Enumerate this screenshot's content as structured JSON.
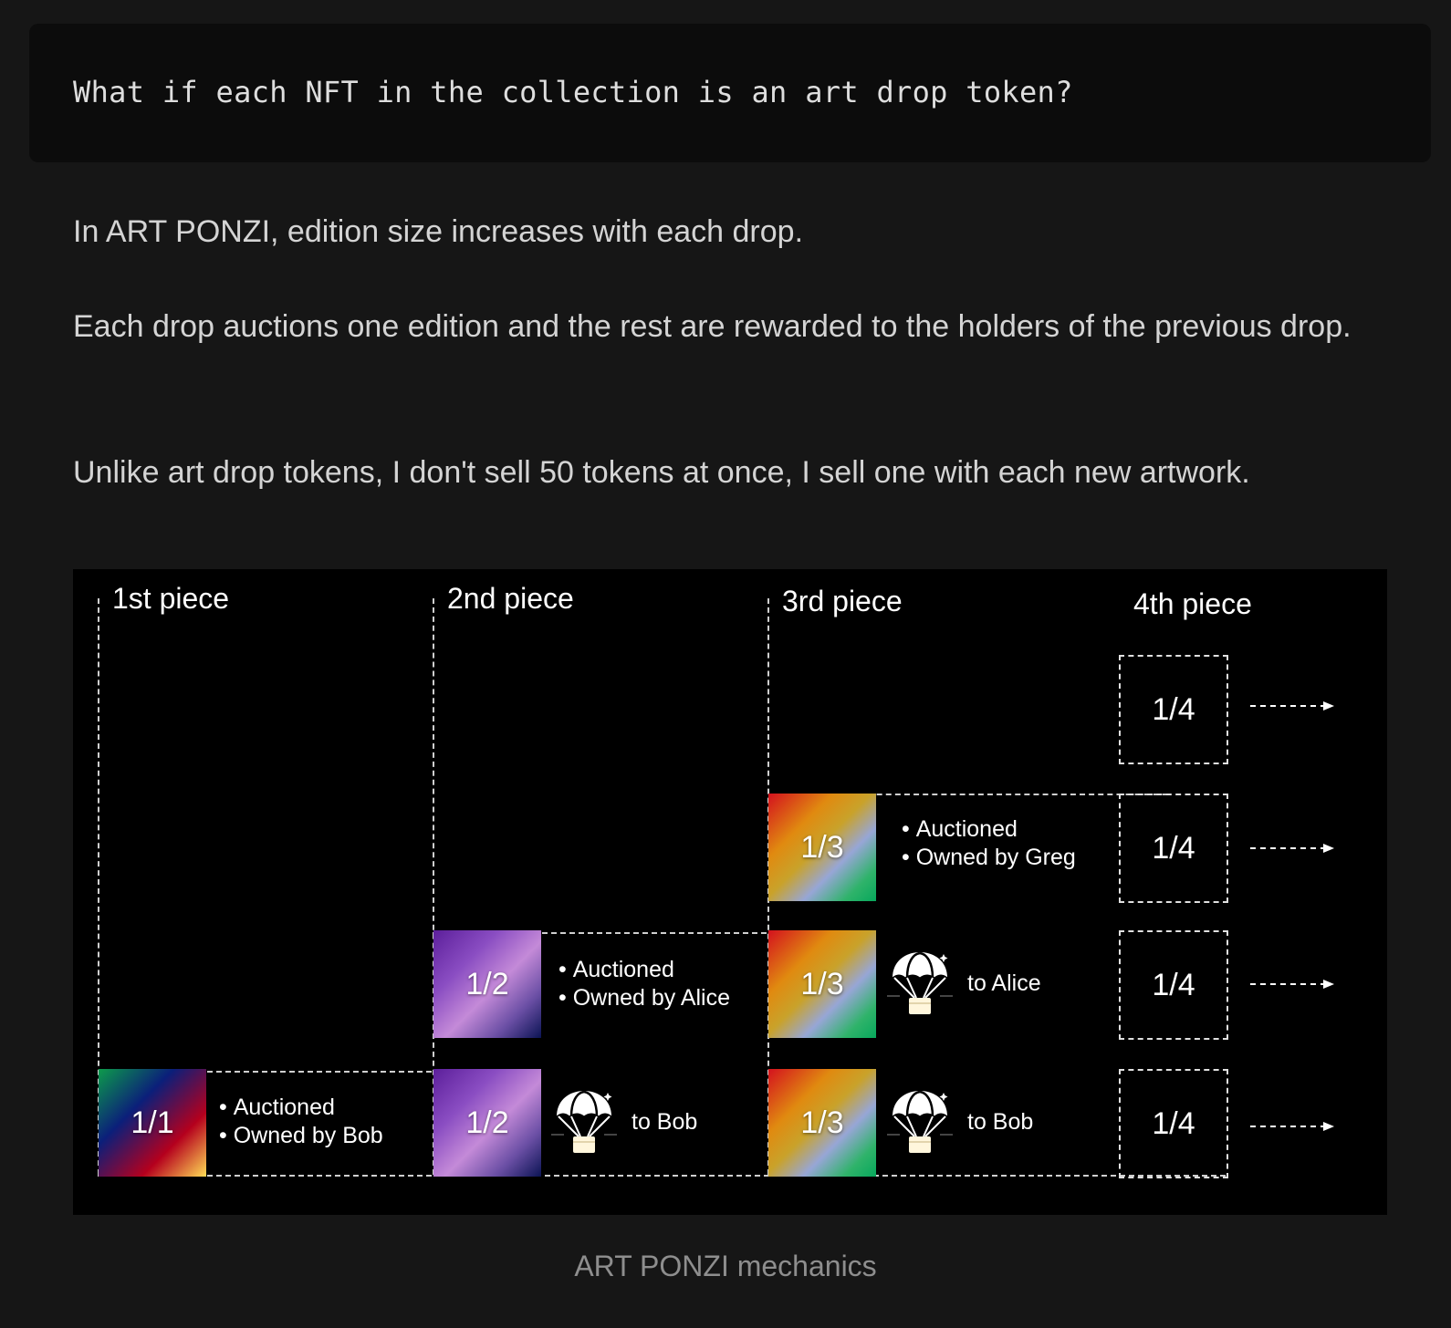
{
  "question": "What if each NFT in the collection is an art drop token?",
  "paragraphs": [
    "In ART PONZI, edition size increases with each drop.",
    "Each drop auctions one edition and the rest are rewarded to the holders of the previous drop.",
    "Unlike art drop tokens, I don't sell 50 tokens at once, I sell one with each new artwork."
  ],
  "diagram": {
    "columns": [
      "1st piece",
      "2nd piece",
      "3rd piece",
      "4th piece"
    ],
    "tiles": {
      "p1_r1": "1/1",
      "p2_r1": "1/2",
      "p2_r2": "1/2",
      "p3_r1": "1/3",
      "p3_r2": "1/3",
      "p3_r3": "1/3",
      "p4_r1": "1/4",
      "p4_r2": "1/4",
      "p4_r3": "1/4",
      "p4_r4": "1/4"
    },
    "auctioned_label": "Auctioned",
    "owners": {
      "piece1": "Owned by Bob",
      "piece2": "Owned by Alice",
      "piece3": "Owned by Greg"
    },
    "airdrops": {
      "p2_r1": "to Bob",
      "p3_r2": "to Alice",
      "p3_r1": "to Bob"
    },
    "icons": {
      "airdrop": "parachute-airdrop-icon",
      "next": "dashed-arrow-icon"
    }
  },
  "caption": "ART PONZI mechanics",
  "colors": {
    "background": "#161616",
    "code_background": "#0c0c0c",
    "diagram_background": "#000000"
  }
}
